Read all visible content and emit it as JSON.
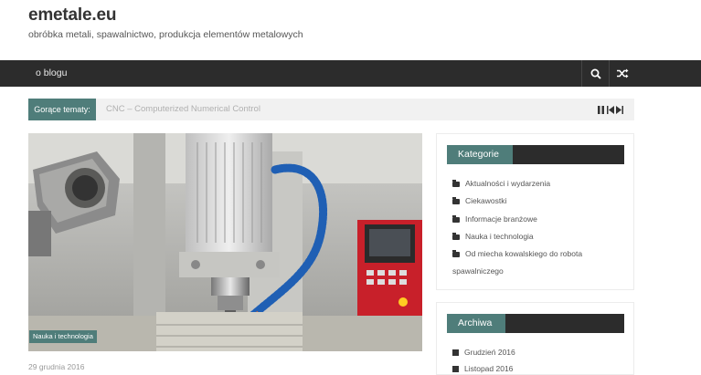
{
  "site": {
    "title": "emetale.eu",
    "tagline": "obróbka metali, spawalnictwo, produkcja elementów metalowych"
  },
  "nav": {
    "items": [
      "o blogu"
    ],
    "search_icon": "search-icon",
    "random_icon": "shuffle-icon"
  },
  "ticker": {
    "label": "Gorące tematy:",
    "text": "CNC – Computerized Numerical Control",
    "controls": [
      "pause-icon",
      "prev-icon",
      "next-icon"
    ]
  },
  "post": {
    "category": "Nauka i technologia",
    "date": "29 grudnia 2016"
  },
  "sidebar": {
    "categories": {
      "title": "Kategorie",
      "items": [
        "Aktualności i wydarzenia",
        "Ciekawostki",
        "Informacje branżowe",
        "Nauka i technologia",
        "Od miecha kowalskiego do robota",
        "spawalniczego"
      ]
    },
    "archive": {
      "title": "Archiwa",
      "items": [
        "Grudzień 2016",
        "Listopad 2016"
      ]
    }
  },
  "colors": {
    "accent": "#4f7d7a",
    "navbar": "#2c2c2c"
  }
}
